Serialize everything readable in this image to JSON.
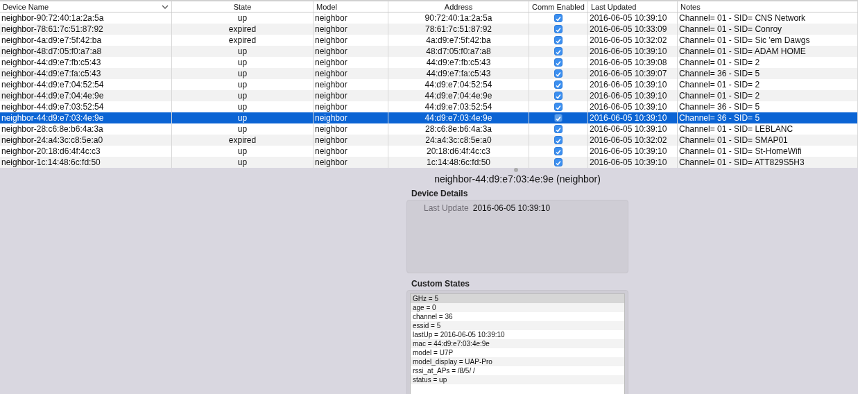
{
  "table": {
    "columns": [
      {
        "label": "Device Name",
        "sorted": true
      },
      {
        "label": "State",
        "sorted": false
      },
      {
        "label": "Model",
        "sorted": false
      },
      {
        "label": "Address",
        "sorted": false
      },
      {
        "label": "Comm Enabled",
        "sorted": false
      },
      {
        "label": "Last Updated",
        "sorted": false
      },
      {
        "label": "Notes",
        "sorted": false
      }
    ],
    "rows": [
      {
        "name": "neighbor-90:72:40:1a:2a:5a",
        "state": "up",
        "model": "neighbor",
        "address": "90:72:40:1a:2a:5a",
        "comm_enabled": true,
        "last_updated": "2016-06-05 10:39:10",
        "notes": "Channel= 01 - SID= CNS Network",
        "selected": false
      },
      {
        "name": "neighbor-78:61:7c:51:87:92",
        "state": "expired",
        "model": "neighbor",
        "address": "78:61:7c:51:87:92",
        "comm_enabled": true,
        "last_updated": "2016-06-05 10:33:09",
        "notes": "Channel= 01 - SID= Conroy",
        "selected": false
      },
      {
        "name": "neighbor-4a:d9:e7:5f:42:ba",
        "state": "expired",
        "model": "neighbor",
        "address": "4a:d9:e7:5f:42:ba",
        "comm_enabled": true,
        "last_updated": "2016-06-05 10:32:02",
        "notes": "Channel= 01 - SID= Sic 'em Dawgs",
        "selected": false
      },
      {
        "name": "neighbor-48:d7:05:f0:a7:a8",
        "state": "up",
        "model": "neighbor",
        "address": "48:d7:05:f0:a7:a8",
        "comm_enabled": true,
        "last_updated": "2016-06-05 10:39:10",
        "notes": "Channel= 01 - SID= ADAM HOME",
        "selected": false
      },
      {
        "name": "neighbor-44:d9:e7:fb:c5:43",
        "state": "up",
        "model": "neighbor",
        "address": "44:d9:e7:fb:c5:43",
        "comm_enabled": true,
        "last_updated": "2016-06-05 10:39:08",
        "notes": "Channel= 01 - SID= 2",
        "selected": false
      },
      {
        "name": "neighbor-44:d9:e7:fa:c5:43",
        "state": "up",
        "model": "neighbor",
        "address": "44:d9:e7:fa:c5:43",
        "comm_enabled": true,
        "last_updated": "2016-06-05 10:39:07",
        "notes": "Channel= 36 - SID= 5",
        "selected": false
      },
      {
        "name": "neighbor-44:d9:e7:04:52:54",
        "state": "up",
        "model": "neighbor",
        "address": "44:d9:e7:04:52:54",
        "comm_enabled": true,
        "last_updated": "2016-06-05 10:39:10",
        "notes": "Channel= 01 - SID= 2",
        "selected": false
      },
      {
        "name": "neighbor-44:d9:e7:04:4e:9e",
        "state": "up",
        "model": "neighbor",
        "address": "44:d9:e7:04:4e:9e",
        "comm_enabled": true,
        "last_updated": "2016-06-05 10:39:10",
        "notes": "Channel= 01 - SID= 2",
        "selected": false
      },
      {
        "name": "neighbor-44:d9:e7:03:52:54",
        "state": "up",
        "model": "neighbor",
        "address": "44:d9:e7:03:52:54",
        "comm_enabled": true,
        "last_updated": "2016-06-05 10:39:10",
        "notes": "Channel= 36 - SID= 5",
        "selected": false
      },
      {
        "name": "neighbor-44:d9:e7:03:4e:9e",
        "state": "up",
        "model": "neighbor",
        "address": "44:d9:e7:03:4e:9e",
        "comm_enabled": true,
        "last_updated": "2016-06-05 10:39:10",
        "notes": "Channel= 36 - SID= 5",
        "selected": true
      },
      {
        "name": "neighbor-28:c6:8e:b6:4a:3a",
        "state": "up",
        "model": "neighbor",
        "address": "28:c6:8e:b6:4a:3a",
        "comm_enabled": true,
        "last_updated": "2016-06-05 10:39:10",
        "notes": "Channel= 01 - SID= LEBLANC",
        "selected": false
      },
      {
        "name": "neighbor-24:a4:3c:c8:5e:a0",
        "state": "expired",
        "model": "neighbor",
        "address": "24:a4:3c:c8:5e:a0",
        "comm_enabled": true,
        "last_updated": "2016-06-05 10:32:02",
        "notes": "Channel= 01 - SID= SMAP01",
        "selected": false
      },
      {
        "name": "neighbor-20:18:d6:4f:4c:c3",
        "state": "up",
        "model": "neighbor",
        "address": "20:18:d6:4f:4c:c3",
        "comm_enabled": true,
        "last_updated": "2016-06-05 10:39:10",
        "notes": "Channel= 01 - SID= St-HomeWifi",
        "selected": false
      },
      {
        "name": "neighbor-1c:14:48:6c:fd:50",
        "state": "up",
        "model": "neighbor",
        "address": "1c:14:48:6c:fd:50",
        "comm_enabled": true,
        "last_updated": "2016-06-05 10:39:10",
        "notes": "Channel= 01 - SID= ATT829S5H3",
        "selected": false
      }
    ]
  },
  "detail": {
    "title": "neighbor-44:d9:e7:03:4e:9e (neighbor)",
    "device_details": {
      "heading": "Device Details",
      "fields": [
        {
          "label": "Last Update",
          "value": "2016-06-05 10:39:10"
        }
      ]
    },
    "custom_states": {
      "heading": "Custom States",
      "items": [
        {
          "text": "GHz = 5",
          "selected": true
        },
        {
          "text": "age = 0",
          "selected": false
        },
        {
          "text": "channel = 36",
          "selected": false
        },
        {
          "text": "essid = 5",
          "selected": false
        },
        {
          "text": "lastUp = 2016-06-05 10:39:10",
          "selected": false
        },
        {
          "text": "mac = 44:d9:e7:03:4e:9e",
          "selected": false
        },
        {
          "text": "model = U7P",
          "selected": false
        },
        {
          "text": "model_display = UAP-Pro",
          "selected": false
        },
        {
          "text": "rssi_at_APs =  /8/5/ /",
          "selected": false
        },
        {
          "text": "status = up",
          "selected": false
        }
      ]
    }
  }
}
